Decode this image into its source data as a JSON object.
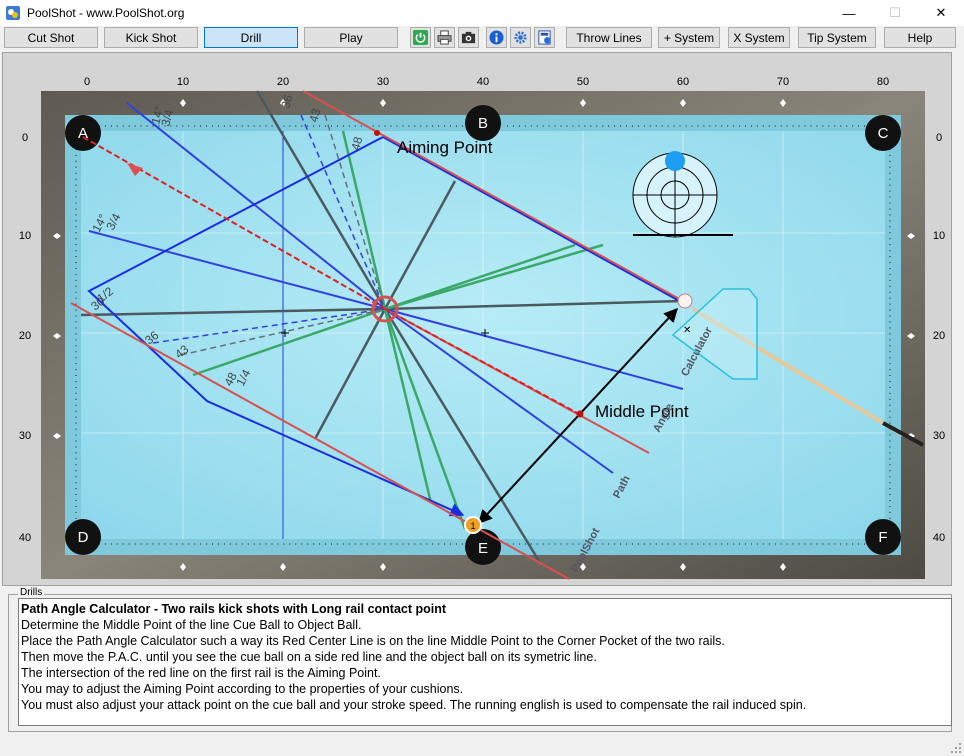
{
  "window": {
    "title": "PoolShot - www.PoolShot.org",
    "controls": {
      "minimize": "—",
      "maximize": "☐",
      "close": "✕"
    }
  },
  "toolbar": {
    "cut_shot": "Cut Shot",
    "kick_shot": "Kick Shot",
    "drill": "Drill",
    "play": "Play",
    "throw_lines": "Throw Lines",
    "plus_system": "+ System",
    "x_system": "X System",
    "tip_system": "Tip System",
    "help": "Help",
    "icons": [
      "power-icon",
      "print-icon",
      "camera-icon",
      "info-icon",
      "settings-icon",
      "calculator-icon"
    ]
  },
  "table": {
    "x_ticks": [
      "0",
      "10",
      "20",
      "30",
      "40",
      "50",
      "60",
      "70",
      "80"
    ],
    "y_ticks": [
      "0",
      "10",
      "20",
      "30",
      "40"
    ],
    "pockets": {
      "a": "A",
      "b": "B",
      "c": "C",
      "d": "D",
      "e": "E",
      "f": "F"
    },
    "labels": {
      "aiming_point": "Aiming Point",
      "middle_point": "Middle Point",
      "calculator": "Calculator",
      "angle": "Angle",
      "path": "Path",
      "poolshot": "PoolShot"
    },
    "angle_labels": {
      "a14_top": "14°",
      "a34_top": "3/4",
      "a36_top": "36",
      "a43_top": "43",
      "a48_top": "48",
      "a14_left": "14°",
      "a34_left": "3/4",
      "a30_left": "30",
      "a12_left": "1/2",
      "a36_left": "36",
      "a43_left": "43",
      "a48_left": "48",
      "a14_bottom": "1/4"
    },
    "object_ball_number": "1"
  },
  "drills": {
    "legend": "Drills",
    "title": "Path Angle Calculator - Two rails kick shots with Long rail contact point",
    "lines": [
      "Determine the Middle Point of the line Cue Ball to Object Ball.",
      "Place the Path Angle Calculator such a way its Red Center Line is on the line Middle Point to the Corner Pocket of the two rails.",
      "Then move the P.A.C. until you see the cue ball on a side red line and the object ball on its symetric line.",
      "The intersection of the red line on the first rail is the Aiming Point.",
      "You may to adjust the Aiming Point according to the properties of your cushions.",
      "You must also adjust your attack point on the cue ball and your stroke speed. The running english is used to compensate the rail induced spin."
    ]
  }
}
